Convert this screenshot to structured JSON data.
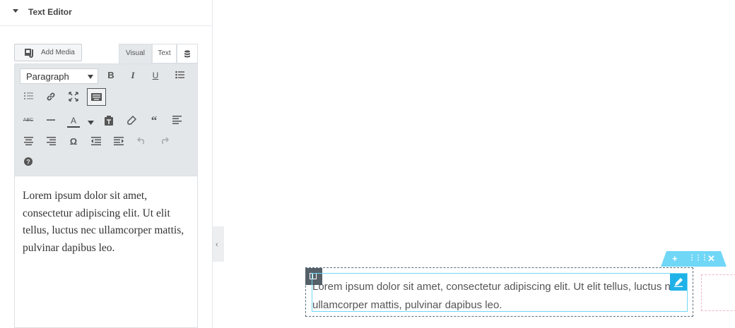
{
  "panel": {
    "section_title": "Text Editor",
    "add_media_label": "Add Media",
    "tabs": {
      "visual": "Visual",
      "text": "Text"
    },
    "format_select": "Paragraph",
    "toolbar_icons": [
      "bold-icon",
      "italic-icon",
      "underline-icon",
      "bullet-list-icon",
      "numbered-list-icon",
      "link-icon",
      "fullscreen-icon",
      "toolbar-toggle-icon",
      "strikethrough-icon",
      "horizontal-line-icon",
      "text-color-icon",
      "paste-text-icon",
      "clear-formatting-icon",
      "blockquote-icon",
      "align-left-icon",
      "align-center-icon",
      "align-right-icon",
      "special-character-icon",
      "outdent-icon",
      "indent-icon",
      "undo-icon",
      "redo-icon",
      "help-icon"
    ],
    "editor_text": "Lorem ipsum dolor sit amet, consectetur adipiscing elit. Ut elit tellus, luctus nec ullamcorper mattis, pulvinar dapibus leo."
  },
  "preview": {
    "widget_text": "Lorem ipsum dolor sit amet, consectetur adipiscing elit. Ut elit tellus, luctus nec ullamcorper mattis, pulvinar dapibus leo.",
    "accent_color": "#71d7f7",
    "edit_color": "#1fb2e8"
  }
}
